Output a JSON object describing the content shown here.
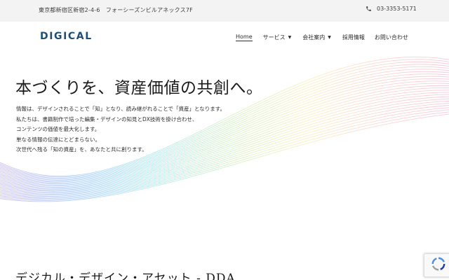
{
  "topbar": {
    "address": "東京都新宿区新宿2-4-6　フォーシーズンビルアネックス7F",
    "phone": "03-3353-5171",
    "phone_icon": "phone-icon"
  },
  "header": {
    "logo": "DIGICAL",
    "nav": [
      {
        "label": "Home",
        "active": true
      },
      {
        "label": "サービス",
        "dropdown": true
      },
      {
        "label": "会社案内",
        "dropdown": true
      },
      {
        "label": "採用情報"
      },
      {
        "label": "お問い合わせ"
      }
    ]
  },
  "hero": {
    "headline": "本づくりを、資産価値の共創へ。",
    "lines": [
      "情報は、デザインされることで「知」となり、読み継がれることで「資産」となります。",
      "私たちは、書籍制作で培った編集・デザインの知見とDX技術を掛け合わせ、",
      "コンテンツの価値を最大化します。",
      "単なる情報の伝達にとどまらない。",
      "次世代へ残る「知の資産」を、あなたと共に創ります。"
    ]
  },
  "section": {
    "heading": "デジカル・デザイン・アセット - DDA"
  },
  "colors": {
    "logo": "#1f4d73",
    "topbar_bg": "#f3f3f3",
    "text": "#1a1a1a"
  }
}
